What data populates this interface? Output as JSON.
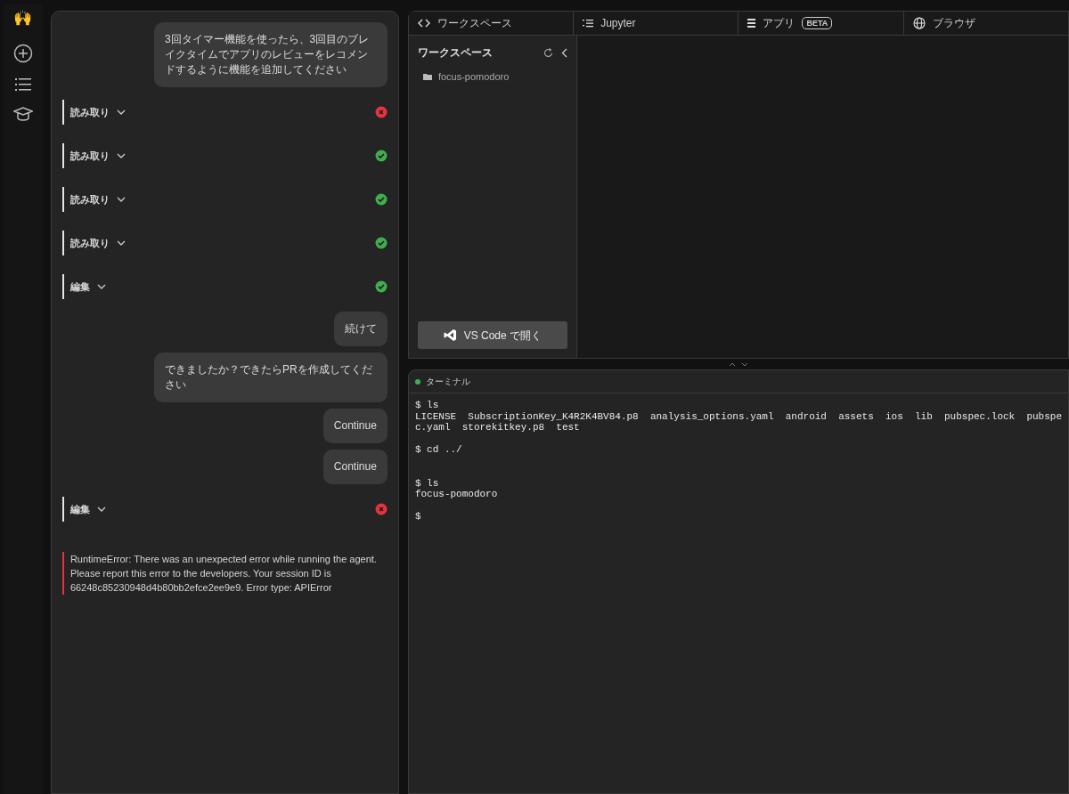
{
  "rail": {
    "logo": "🙌"
  },
  "chat": [
    {
      "kind": "user",
      "text": "3回タイマー機能を使ったら、3回目のブレイクタイムでアプリのレビューをレコメンドするように機能を追加してください"
    },
    {
      "kind": "step",
      "label": "読み取り",
      "success": false
    },
    {
      "kind": "step",
      "label": "読み取り",
      "success": true
    },
    {
      "kind": "step",
      "label": "読み取り",
      "success": true
    },
    {
      "kind": "step",
      "label": "読み取り",
      "success": true
    },
    {
      "kind": "step",
      "label": "編集",
      "success": true
    },
    {
      "kind": "user",
      "text": "続けて"
    },
    {
      "kind": "user",
      "text": "できましたか？できたらPRを作成してください"
    },
    {
      "kind": "user",
      "text": "Continue"
    },
    {
      "kind": "user",
      "text": "Continue"
    },
    {
      "kind": "step",
      "label": "編集",
      "success": false
    },
    {
      "kind": "error",
      "text": "RuntimeError: There was an unexpected error while running the agent. Please report this error to the developers. Your session ID is 66248c85230948d4b80bb2efce2ee9e9. Error type: APIError"
    }
  ],
  "tabs": [
    {
      "kind": "code",
      "label": "ワークスペース"
    },
    {
      "kind": "list",
      "label": "Jupyter"
    },
    {
      "kind": "app",
      "label": "アプリ",
      "badge": "BETA"
    },
    {
      "kind": "globe",
      "label": "ブラウザ"
    }
  ],
  "workspace": {
    "title": "ワークスペース",
    "items": [
      "focus-pomodoro"
    ],
    "open_button": "VS Code で開く"
  },
  "terminal": {
    "title": "ターミナル",
    "output": "$ ls\nLICENSE  SubscriptionKey_K4R2K4BV84.p8  analysis_options.yaml  android  assets  ios  lib  pubspec.lock  pubspe\nc.yaml  storekitkey.p8  test\n\n$ cd ../\n\n\n$ ls\nfocus-pomodoro\n\n$"
  }
}
